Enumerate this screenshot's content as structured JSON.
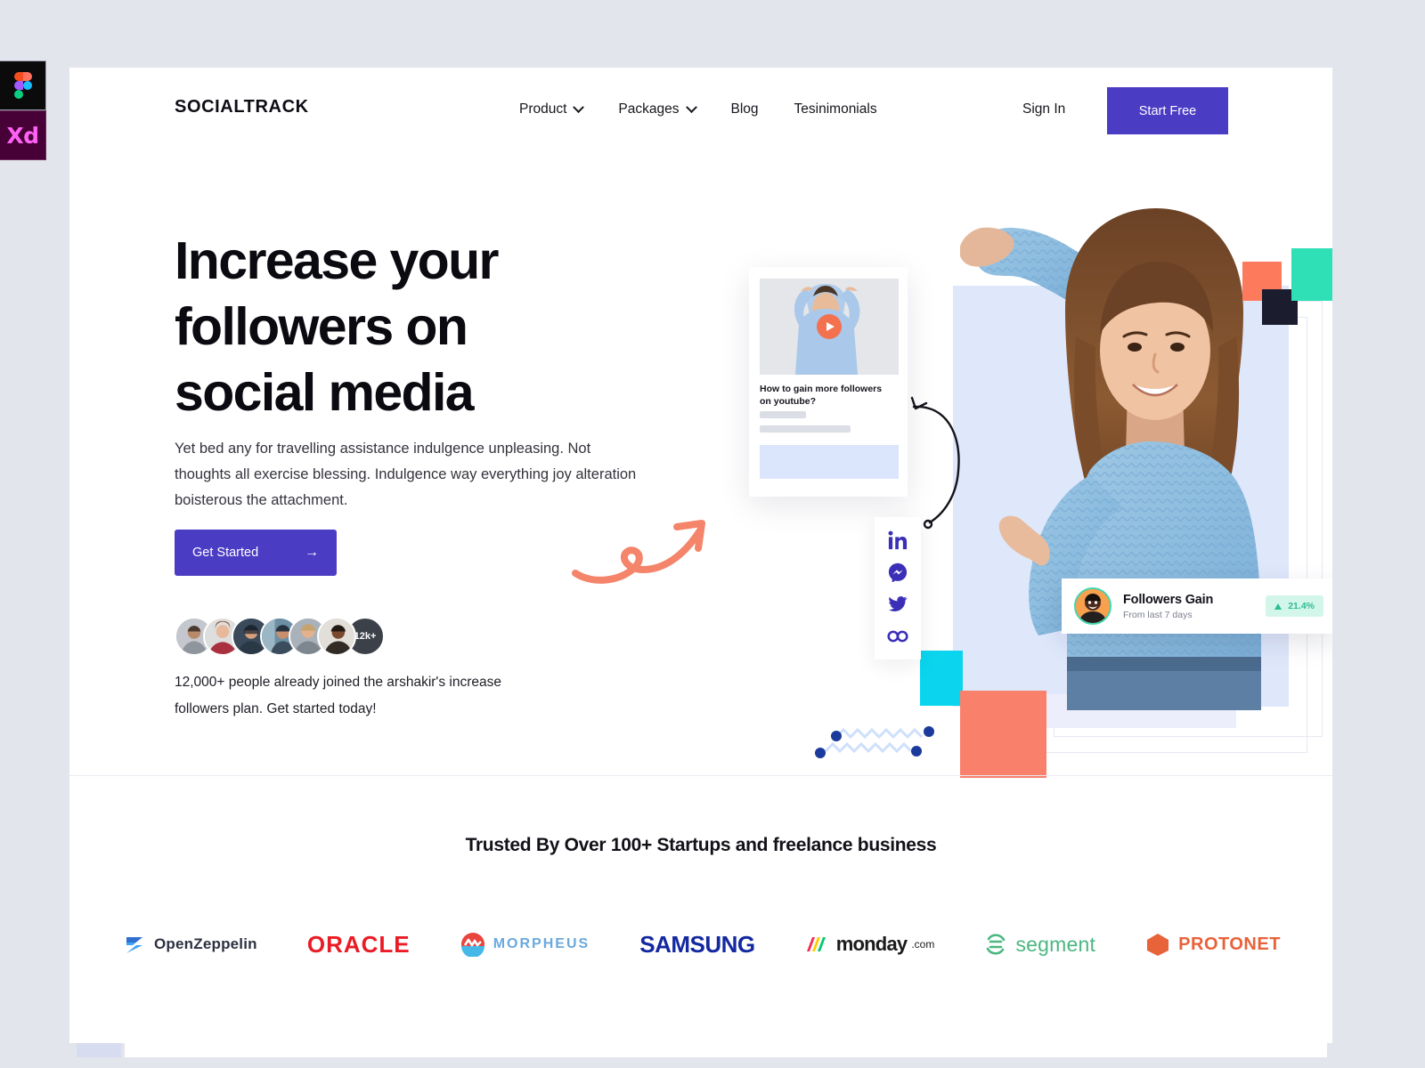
{
  "app_rail": {
    "items": [
      {
        "name": "figma",
        "label": ""
      },
      {
        "name": "adobe-xd",
        "label": "Xd"
      }
    ]
  },
  "nav": {
    "brand": "SOCIALTRACK",
    "links": [
      {
        "label": "Product",
        "has_dropdown": true
      },
      {
        "label": "Packages",
        "has_dropdown": true
      },
      {
        "label": "Blog",
        "has_dropdown": false
      },
      {
        "label": "Tesinimonials",
        "has_dropdown": false
      }
    ],
    "signin_label": "Sign In",
    "cta_label": "Start Free"
  },
  "hero": {
    "title": "Increase your followers on social media",
    "subtitle": "Yet bed any for travelling assistance indulgence unpleasing. Not thoughts all exercise blessing. Indulgence way everything joy alteration boisterous the attachment.",
    "cta_label": "Get Started",
    "cta_arrow": "→",
    "avatar_count_label": "12k+",
    "avatar_colors": [
      "#b9bcc4",
      "#a63a46",
      "#2d3b4b",
      "#5f7f92",
      "#9aa2ac",
      "#d7cfc6"
    ],
    "joined_text": "12,000+ people already joined the arshakir's increase followers plan. Get started today!"
  },
  "video_card": {
    "title": "How to gain more followers on youtube?",
    "play_icon": "play-icon"
  },
  "social": {
    "items": [
      {
        "name": "linkedin-icon",
        "label": "in"
      },
      {
        "name": "messenger-icon",
        "label": ""
      },
      {
        "name": "twitter-icon",
        "label": ""
      },
      {
        "name": "infinity-icon",
        "label": "∞"
      }
    ],
    "color": "#3b2fb8"
  },
  "followers_card": {
    "title": "Followers Gain",
    "subtitle": "From last 7 days",
    "change_value": "21.4%",
    "change_direction": "up",
    "badge_bg": "#d3f6ea",
    "badge_color": "#2bbd95"
  },
  "trusted": {
    "heading": "Trusted By Over 100+ Startups and freelance business",
    "logos": [
      {
        "name": "openzeppelin",
        "text": "OpenZeppelin",
        "color": "#2d3142",
        "mark_color": "#3fa3f5"
      },
      {
        "name": "oracle",
        "text": "ORACLE",
        "color": "#ea1b25",
        "mark_color": "#ea1b25"
      },
      {
        "name": "morpheus",
        "text": "MORPHEUS",
        "color": "#6aa9dd",
        "mark_color": "#e8453c"
      },
      {
        "name": "samsung",
        "text": "SAMSUNG",
        "color": "#1428a0",
        "mark_color": "#1428a0"
      },
      {
        "name": "monday",
        "text": "monday",
        "suffix": ".com",
        "color": "#1a1a1a",
        "mark_color": "#f62b54"
      },
      {
        "name": "segment",
        "text": "segment",
        "color": "#4bb781",
        "mark_color": "#4bb781"
      },
      {
        "name": "protonet",
        "text": "PROTONET",
        "color": "#e8623a",
        "mark_color": "#e8623a"
      }
    ]
  },
  "decor": {
    "square_coral_top": "#fd7b5c",
    "square_navy_top": "#1b1d2e",
    "square_mint_top": "#2fdfb6",
    "square_cyan": "#0bd5ee",
    "square_coral_big": "#f9806a",
    "panel_lavender": "#dfe7fb",
    "arrow_color": "#f4846a",
    "dot_color": "#1b3a9b"
  },
  "theme": {
    "accent_purple": "#4b3cc4",
    "page_bg": "#e3e5ec",
    "card_bg": "#ffffff",
    "text_dark": "#0a0a10"
  }
}
